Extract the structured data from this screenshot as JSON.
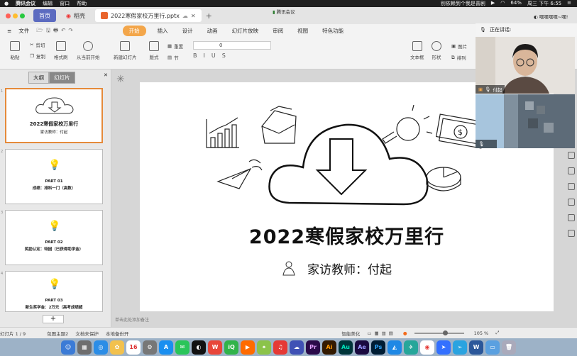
{
  "menubar": {
    "app": "腾讯会议",
    "items": [
      "编辑",
      "窗口",
      "帮助"
    ],
    "song": "别依赖到个我是喜剧",
    "battery": "64%",
    "datetime": "周三 下午 6:55"
  },
  "tabs": {
    "home": "首页",
    "shell": "稻壳",
    "doc": "2022寒假家校万里行.pptx",
    "meeting_title": "腾讯会议",
    "user": "嘿嘿嘿嘿~嘿!"
  },
  "ribbon_tabs": {
    "file": "文件",
    "items": [
      "开始",
      "插入",
      "设计",
      "动画",
      "幻灯片放映",
      "审阅",
      "视图",
      "特色功能"
    ]
  },
  "ribbon": {
    "paste": "粘贴",
    "cut": "剪切",
    "copy": "复制",
    "format_painter": "格式刷",
    "from_current": "从当前开始",
    "new_slide": "新建幻灯片",
    "layout": "版式",
    "reset": "重置",
    "section": "节",
    "font_size": "0",
    "textbox": "文本框",
    "shape": "形状",
    "picture": "图片",
    "arrange": "排列"
  },
  "panel": {
    "tab_outline": "大纲",
    "tab_slides": "幻灯片",
    "add_label": "+",
    "thumbs": [
      {
        "num": "1",
        "title": "2022寒假家校万里行",
        "sub": "家访教师：付起"
      },
      {
        "num": "2",
        "title": "PART 01",
        "sub": "成绩：排科一门（高数）"
      },
      {
        "num": "3",
        "title": "PART 02",
        "sub": "奖励认定：特困（已获得助学金）"
      },
      {
        "num": "4",
        "title": "PART 03",
        "sub": "新生奖学金：2万元（高考成绩超"
      }
    ]
  },
  "slide": {
    "title": "2022寒假家校万里行",
    "subtitle": "家访教师：付起"
  },
  "notes_placeholder": "单击此处添加备注",
  "video": {
    "speaking_label": "正在讲话:",
    "speaker_name": "付起"
  },
  "status": {
    "slide_pos": "幻灯片 1 / 9",
    "theme": "包图主题2",
    "protect": "文档未保护",
    "backup": "本地备份开",
    "beautify": "智能美化",
    "zoom": "105 %"
  },
  "dock_apps": [
    "Finder",
    "Launchpad",
    "Safari",
    "Photos",
    "Calendar",
    "Preferences",
    "App Store",
    "WeChat",
    "QQ",
    "WPS",
    "iQIYI",
    "Tencent Video",
    "Maps",
    "NetEase",
    "Baidu",
    "Premiere",
    "Illustrator",
    "Audition",
    "After Effects",
    "Photoshop",
    "Tencent Meeting",
    "Lark",
    "Chrome",
    "Feishu",
    "Telegram",
    "Word",
    "Folder",
    "Trash"
  ],
  "colors": {
    "accent_orange": "#f3a64a",
    "home_tab": "#5c6bc0",
    "selected_thumb_border": "#e58a3a"
  }
}
